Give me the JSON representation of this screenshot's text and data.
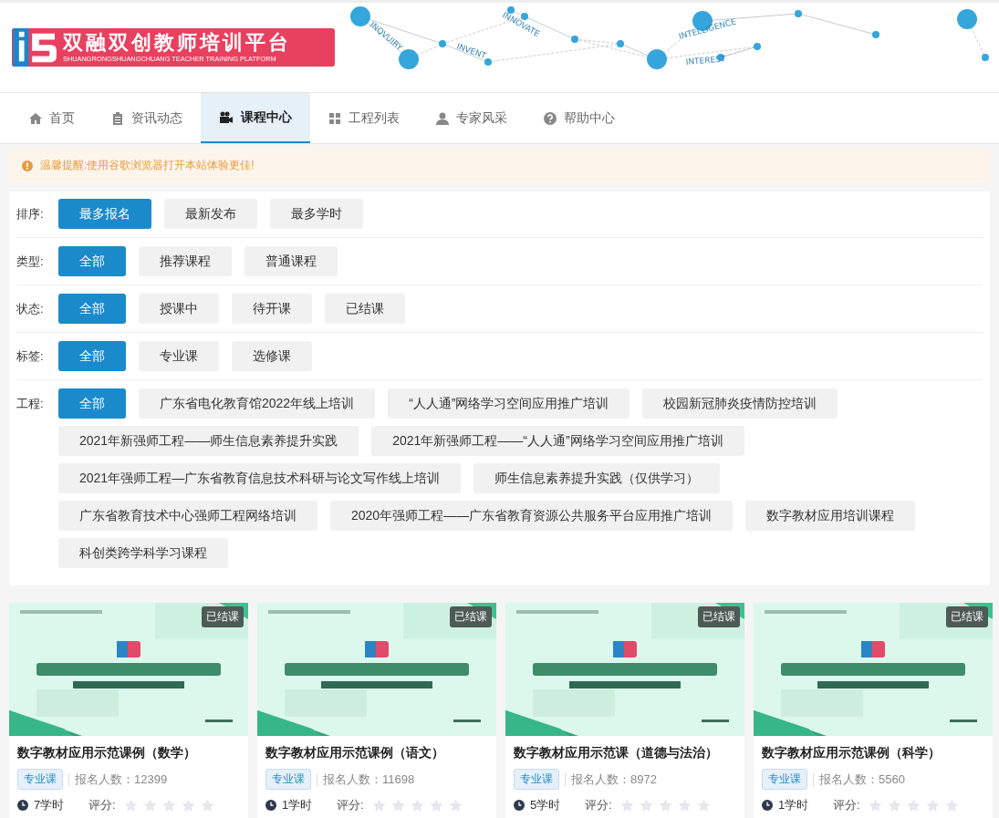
{
  "logo": {
    "title": "双融双创教师培训平台",
    "subtitle": "SHUANGRONGSHUANGCHUANG TEACHER TRAINING PLATFORM"
  },
  "banner_words": [
    "INQVUIRY",
    "INVENT",
    "INNOVATE",
    "INTELLIGENCE",
    "INTEREST"
  ],
  "nav": [
    {
      "label": "首页",
      "selected": false
    },
    {
      "label": "资讯动态",
      "selected": false
    },
    {
      "label": "课程中心",
      "selected": true
    },
    {
      "label": "工程列表",
      "selected": false
    },
    {
      "label": "专家风采",
      "selected": false
    },
    {
      "label": "帮助中心",
      "selected": false
    }
  ],
  "notice": "温馨提醒:使用谷歌浏览器打开本站体验更佳!",
  "filters": [
    {
      "label": "排序:",
      "options": [
        {
          "label": "最多报名",
          "selected": true
        },
        {
          "label": "最新发布",
          "selected": false
        },
        {
          "label": "最多学时",
          "selected": false
        }
      ]
    },
    {
      "label": "类型:",
      "options": [
        {
          "label": "全部",
          "selected": true
        },
        {
          "label": "推荐课程",
          "selected": false
        },
        {
          "label": "普通课程",
          "selected": false
        }
      ]
    },
    {
      "label": "状态:",
      "options": [
        {
          "label": "全部",
          "selected": true
        },
        {
          "label": "授课中",
          "selected": false
        },
        {
          "label": "待开课",
          "selected": false
        },
        {
          "label": "已结课",
          "selected": false
        }
      ]
    },
    {
      "label": "标签:",
      "options": [
        {
          "label": "全部",
          "selected": true
        },
        {
          "label": "专业课",
          "selected": false
        },
        {
          "label": "选修课",
          "selected": false
        }
      ]
    },
    {
      "label": "工程:",
      "options": [
        {
          "label": "全部",
          "selected": true
        },
        {
          "label": "广东省电化教育馆2022年线上培训",
          "selected": false
        },
        {
          "label": "“人人通”网络学习空间应用推广培训",
          "selected": false
        },
        {
          "label": "校园新冠肺炎疫情防控培训",
          "selected": false
        },
        {
          "label": "2021年新强师工程——师生信息素养提升实践",
          "selected": false
        },
        {
          "label": "2021年新强师工程——“人人通”网络学习空间应用推广培训",
          "selected": false
        },
        {
          "label": "2021年强师工程—广东省教育信息技术科研与论文写作线上培训",
          "selected": false
        },
        {
          "label": "师生信息素养提升实践（仅供学习）",
          "selected": false
        },
        {
          "label": "广东省教育技术中心强师工程网络培训",
          "selected": false
        },
        {
          "label": "2020年强师工程——广东省教育资源公共服务平台应用推广培训",
          "selected": false
        },
        {
          "label": "数字教材应用培训课程",
          "selected": false
        },
        {
          "label": "科创类跨学科学习课程",
          "selected": false
        }
      ]
    }
  ],
  "courses": [
    {
      "status": "已结课",
      "title": "数字教材应用示范课例（数学）",
      "tag": "专业课",
      "enrolled": "报名人数：12399",
      "hours": "7学时",
      "rating_label": "评分:",
      "stars": 0
    },
    {
      "status": "已结课",
      "title": "数字教材应用示范课例（语文）",
      "tag": "专业课",
      "enrolled": "报名人数：11698",
      "hours": "1学时",
      "rating_label": "评分:",
      "stars": 0
    },
    {
      "status": "已结课",
      "title": "数字教材应用示范课（道德与法治）",
      "tag": "专业课",
      "enrolled": "报名人数：8972",
      "hours": "5学时",
      "rating_label": "评分:",
      "stars": 0
    },
    {
      "status": "已结课",
      "title": "数字教材应用示范课例（科学）",
      "tag": "专业课",
      "enrolled": "报名人数：5560",
      "hours": "1学时",
      "rating_label": "评分:",
      "stars": 0
    }
  ]
}
